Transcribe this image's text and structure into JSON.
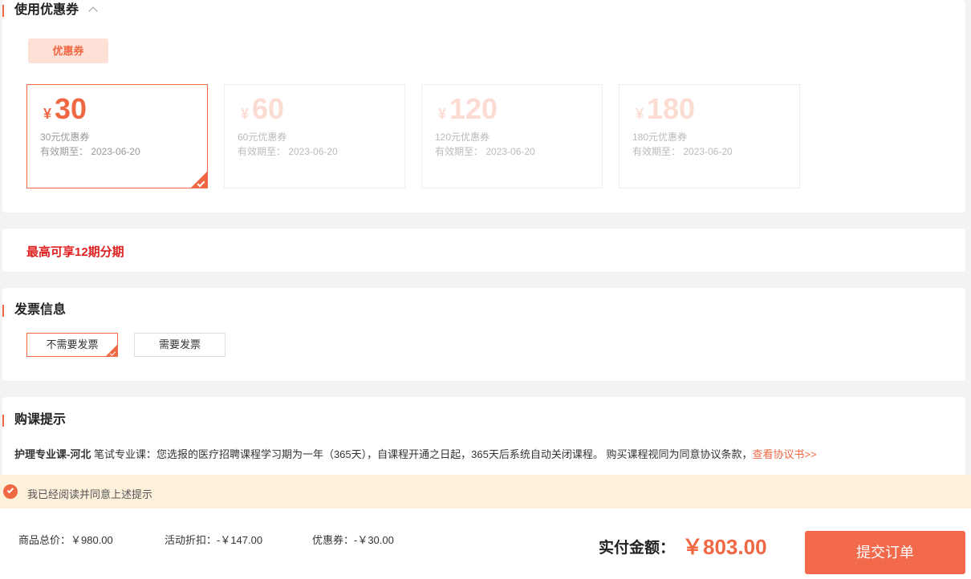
{
  "coupon_section": {
    "title": "使用优惠券",
    "tab_label": "优惠券",
    "coupons": [
      {
        "currency": "¥",
        "amount": "30",
        "name": "30元优惠券",
        "expiry": "有效期至： 2023-06-20",
        "state": "selected"
      },
      {
        "currency": "¥",
        "amount": "60",
        "name": "60元优惠券",
        "expiry": "有效期至： 2023-06-20",
        "state": "disabled"
      },
      {
        "currency": "¥",
        "amount": "120",
        "name": "120元优惠券",
        "expiry": "有效期至： 2023-06-20",
        "state": "disabled"
      },
      {
        "currency": "¥",
        "amount": "180",
        "name": "180元优惠券",
        "expiry": "有效期至： 2023-06-20",
        "state": "disabled"
      }
    ]
  },
  "installment": {
    "text": "最高可享12期分期"
  },
  "invoice": {
    "title": "发票信息",
    "options": [
      {
        "label": "不需要发票",
        "selected": true
      },
      {
        "label": "需要发票",
        "selected": false
      }
    ]
  },
  "tips": {
    "title": "购课提示",
    "course_name": "护理专业课-河北",
    "body": " 笔试专业课：您选报的医疗招聘课程学习期为一年（365天），自课程开通之日起，365天后系统自动关闭课程。 购买课程视同为同意协议条款，",
    "link_text": "查看协议书>>"
  },
  "agreement": {
    "text": "我已经阅读并同意上述提示",
    "checked": true
  },
  "footer": {
    "subtotal": "商品总价：￥980.00",
    "discount": "活动折扣：-￥147.00",
    "coupon": "优惠券：-￥30.00",
    "total_label": "实付金额：",
    "total_value": "￥803.00",
    "submit_label": "提交订单"
  },
  "colors": {
    "accent": "#f06843",
    "installment_red": "#e02020",
    "agree_bg": "#fdf1dc",
    "page_bg": "#f2f3f5"
  }
}
